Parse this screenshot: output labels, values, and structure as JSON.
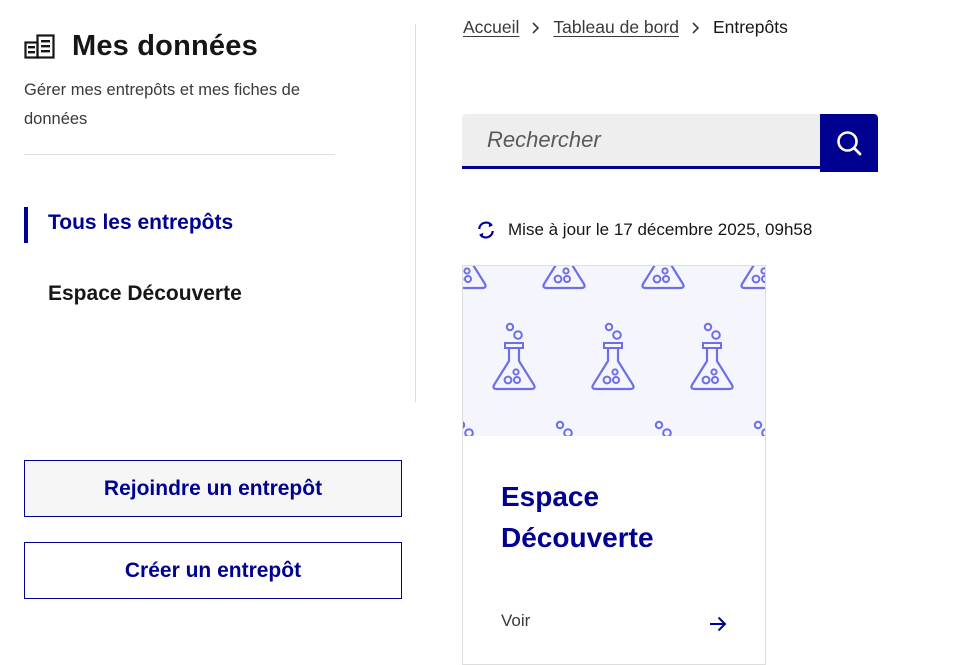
{
  "sidebar": {
    "title": "Mes données",
    "description": "Gérer mes entrepôts et mes fiches de données",
    "nav": [
      {
        "label": "Tous les entrepôts",
        "active": true
      },
      {
        "label": "Espace Découverte",
        "active": false
      }
    ],
    "join_button": "Rejoindre un entrepôt",
    "create_button": "Créer un entrepôt"
  },
  "breadcrumb": {
    "items": [
      "Accueil",
      "Tableau de bord"
    ],
    "current": "Entrepôts"
  },
  "search": {
    "placeholder": "Rechercher"
  },
  "update": {
    "text": "Mise à jour le 17 décembre 2025, 09h58"
  },
  "card": {
    "title": "Espace Découverte",
    "link_label": "Voir"
  },
  "colors": {
    "accent": "#000091",
    "pattern": "#6e6ee6",
    "pattern_bg": "#f5f5fe"
  },
  "icons": {
    "sidebar_title": "database-icon",
    "breadcrumb_sep": "chevron-right-icon",
    "search": "search-icon",
    "update": "refresh-icon",
    "card_image": "flask-pattern",
    "card_link": "arrow-right-icon"
  }
}
